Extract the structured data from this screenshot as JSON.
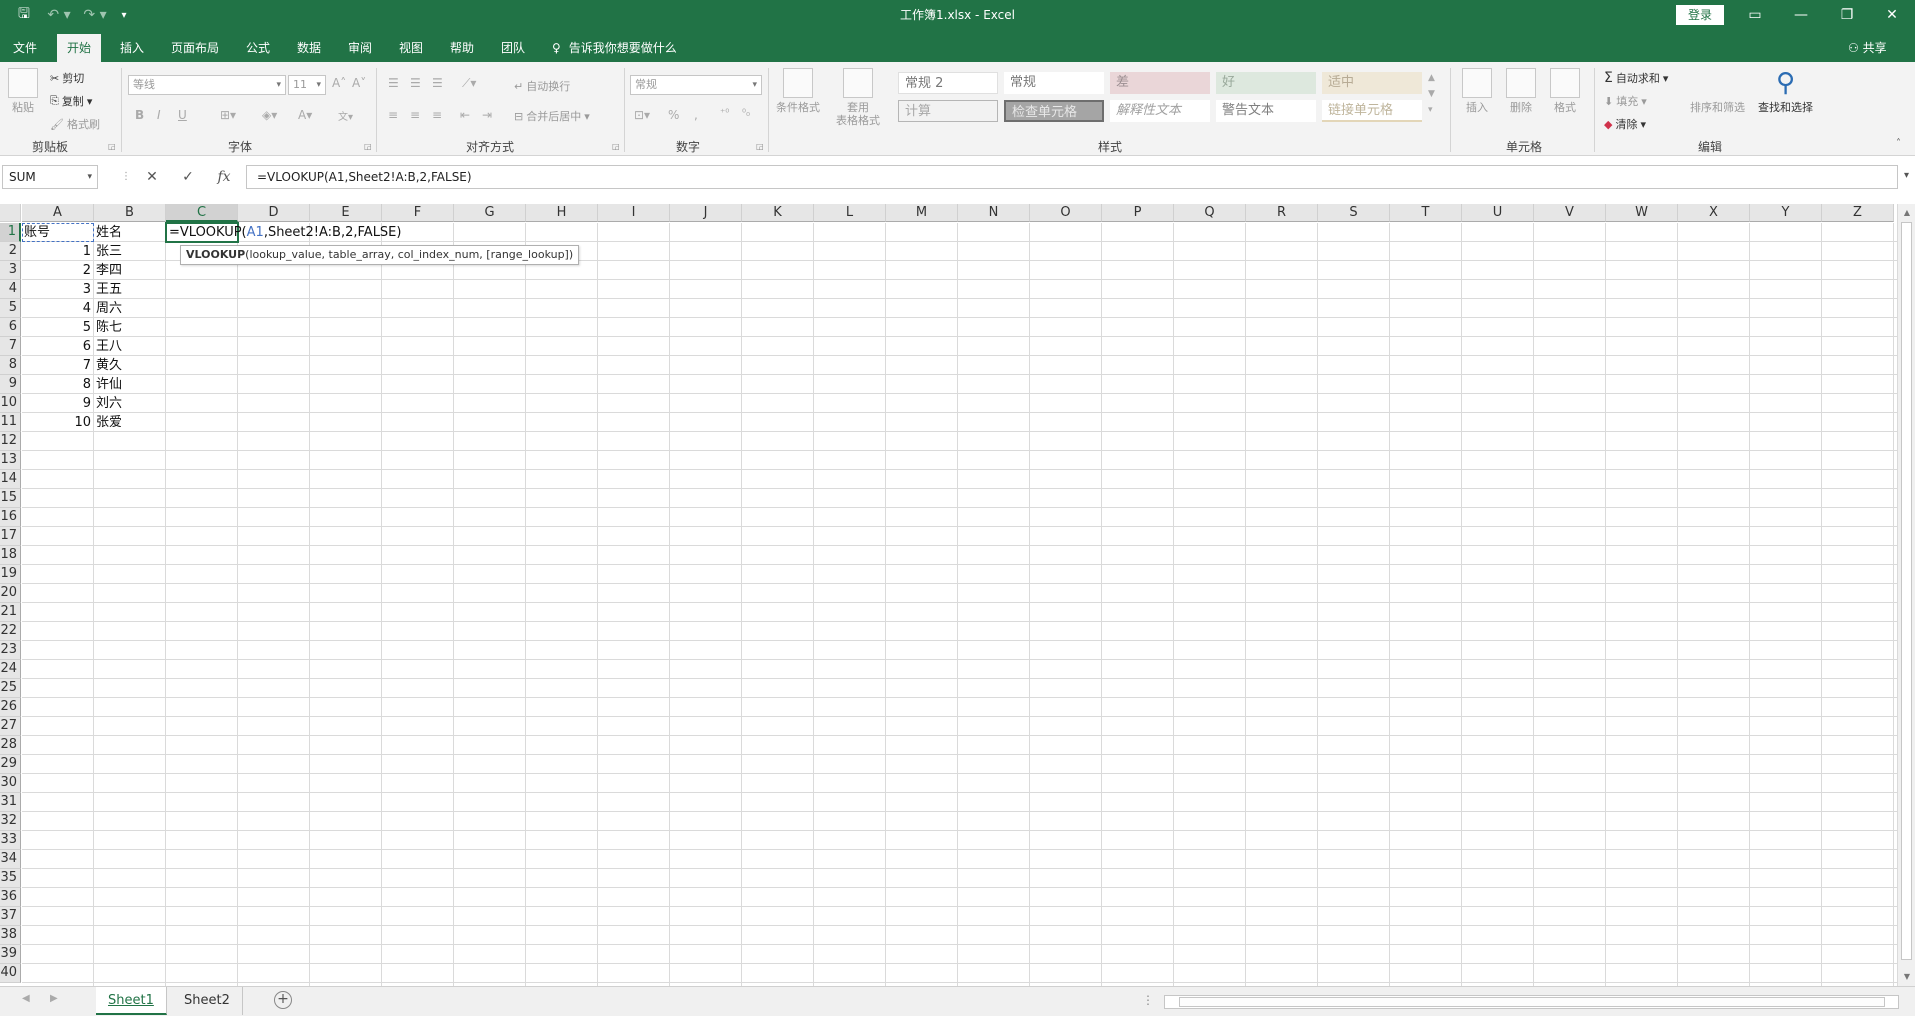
{
  "titlebar": {
    "title": "工作簿1.xlsx  -  Excel",
    "login": "登录",
    "qa_save": "🖫",
    "qa_undo": "↶ ▾",
    "qa_redo": "↷ ▾",
    "qa_more": "▾"
  },
  "menu": {
    "tabs": [
      "文件",
      "开始",
      "插入",
      "页面布局",
      "公式",
      "数据",
      "审阅",
      "视图",
      "帮助",
      "团队"
    ],
    "active": "开始",
    "tell_me": "告诉我你想要做什么",
    "share": "共享"
  },
  "ribbon": {
    "clipboard": {
      "paste": "粘贴",
      "cut": "剪切",
      "copy": "复制",
      "format_painter": "格式刷",
      "label": "剪贴板"
    },
    "font": {
      "name": "等线",
      "size": "11",
      "grow": "A˄",
      "shrink": "A˅",
      "bold": "B",
      "italic": "I",
      "underline": "U",
      "label": "字体"
    },
    "alignment": {
      "wrap": "自动换行",
      "merge": "合并后居中",
      "label": "对齐方式"
    },
    "number": {
      "format": "常规",
      "percent": "%",
      "comma": ",",
      "label": "数字"
    },
    "styles": {
      "conditional": "条件格式",
      "table_format": [
        "套用",
        "表格格式"
      ],
      "cells": [
        {
          "label": "常规 2"
        },
        {
          "label": "常规"
        },
        {
          "label": "差"
        },
        {
          "label": "好"
        },
        {
          "label": "适中"
        },
        {
          "label": "计算"
        },
        {
          "label": "检查单元格"
        },
        {
          "label": "解释性文本"
        },
        {
          "label": "警告文本"
        },
        {
          "label": "链接单元格"
        }
      ],
      "label": "样式"
    },
    "cells_group": {
      "insert": "插入",
      "delete": "删除",
      "format": "格式",
      "label": "单元格"
    },
    "editing": {
      "autosum": "自动求和",
      "fill": "填充",
      "clear": "清除",
      "sort": "排序和筛选",
      "find": "查找和选择",
      "label": "编辑"
    }
  },
  "formula_bar": {
    "name_box": "SUM",
    "cancel": "✕",
    "enter": "✓",
    "fx": "fx",
    "formula": "=VLOOKUP(A1,Sheet2!A:B,2,FALSE)"
  },
  "grid": {
    "columns": [
      "A",
      "B",
      "C",
      "D",
      "E",
      "F",
      "G",
      "H",
      "I",
      "J",
      "K",
      "L",
      "M",
      "N",
      "O",
      "P",
      "Q",
      "R",
      "S",
      "T",
      "U",
      "V",
      "W",
      "X",
      "Y",
      "Z"
    ],
    "rows": [
      "1",
      "2",
      "3",
      "4",
      "5",
      "6",
      "7",
      "8",
      "9",
      "10",
      "11",
      "12",
      "13",
      "14",
      "15",
      "16",
      "17",
      "18",
      "19",
      "20",
      "21",
      "22",
      "23",
      "24",
      "25",
      "26",
      "27",
      "28",
      "29",
      "30",
      "31",
      "32",
      "33",
      "34",
      "35",
      "36",
      "37",
      "38",
      "39",
      "40"
    ],
    "a1": "账号",
    "b1": "姓名",
    "ids": [
      "1",
      "2",
      "3",
      "4",
      "5",
      "6",
      "7",
      "8",
      "9",
      "10"
    ],
    "names": [
      "张三",
      "李四",
      "王五",
      "周六",
      "陈七",
      "王八",
      "黄久",
      "许仙",
      "刘六",
      "张爱"
    ],
    "edit_prefix": "=VLOOKUP(",
    "edit_ref": "A1",
    "edit_suffix": ",Sheet2!A:B,2,FALSE)",
    "tooltip_fn": "VLOOKUP",
    "tooltip_args": "(lookup_value, table_array, col_index_num, [range_lookup])"
  },
  "sheets": {
    "tabs": [
      "Sheet1",
      "Sheet2"
    ],
    "active": "Sheet1",
    "add": "+"
  }
}
